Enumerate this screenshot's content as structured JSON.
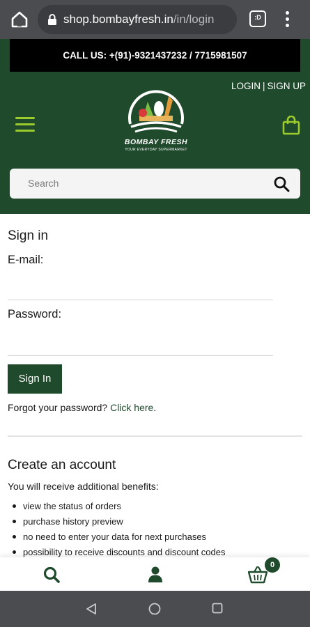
{
  "browser": {
    "url_domain": "shop.bombayfresh.in",
    "url_path": "/in/login",
    "tabs_count": ":D"
  },
  "header": {
    "call_us": "CALL US: +(91)-9321437232 / 7715981507",
    "login_label": "LOGIN",
    "separator": "|",
    "signup_label": "SIGN UP",
    "logo_name": "BOMBAY FRESH",
    "logo_tagline": "YOUR EVERYDAY SUPERMARKET",
    "search_placeholder": "Search"
  },
  "signin": {
    "title": "Sign in",
    "email_label": "E-mail:",
    "email_value": "",
    "password_label": "Password:",
    "password_value": "",
    "button_label": "Sign In",
    "forgot_text": "Forgot your password?",
    "forgot_link": "Click here",
    "forgot_end": "."
  },
  "create_account": {
    "title": "Create an account",
    "intro": "You will receive additional benefits:",
    "benefits": [
      "view the status of orders",
      "purchase history preview",
      "no need to enter your data for next purchases",
      "possibility to receive discounts and discount codes"
    ]
  },
  "bottom_nav": {
    "cart_count": "0"
  },
  "colors": {
    "brand_green": "#1f4a2c",
    "accent_lime": "#9ccb2c",
    "chrome_gray": "#4a4c4f"
  },
  "icons": [
    "home-icon",
    "lock-icon",
    "tabs-icon",
    "overflow-menu-icon",
    "hamburger-icon",
    "shopping-bag-icon",
    "search-icon",
    "account-icon",
    "cart-icon",
    "back-icon",
    "home-circle-icon",
    "recent-apps-icon"
  ]
}
